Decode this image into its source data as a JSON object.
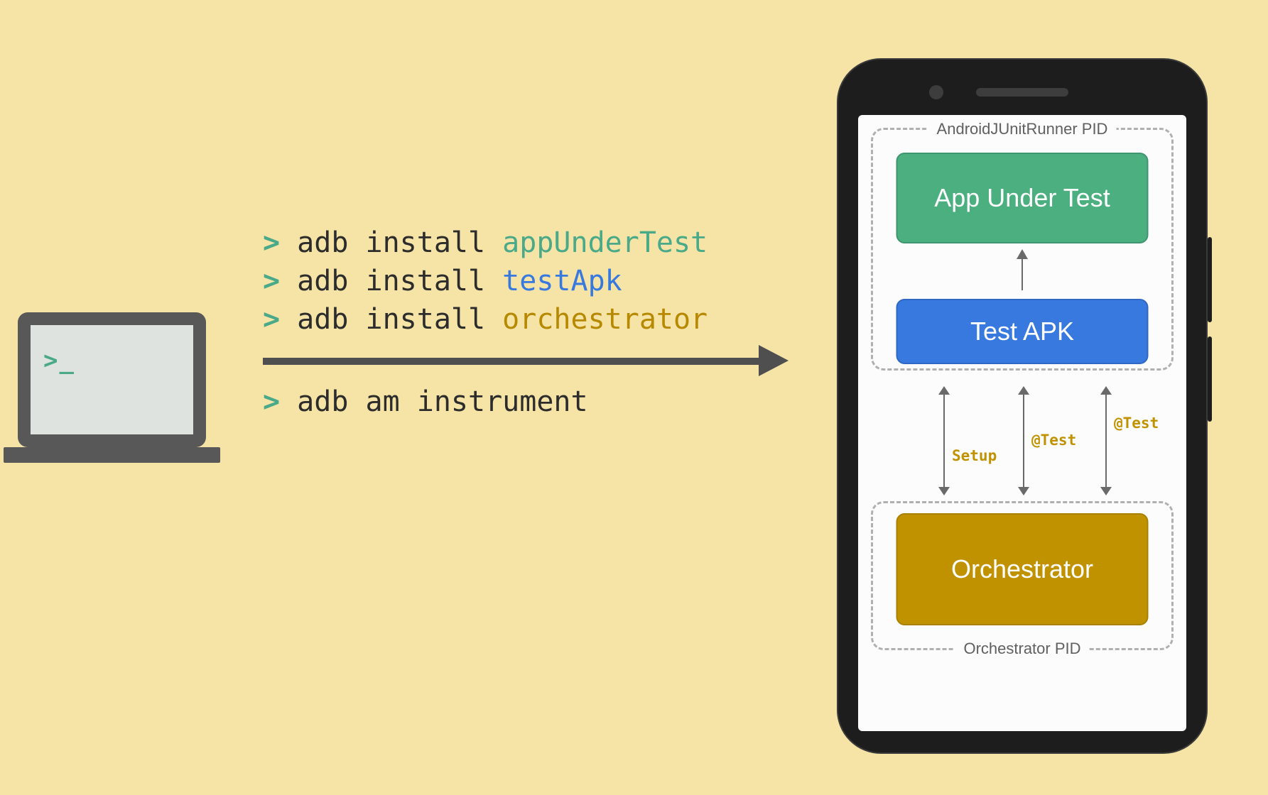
{
  "laptop_prompt": ">_",
  "commands": [
    {
      "caret": "> ",
      "base": "adb install ",
      "arg": "appUnderTest",
      "arg_class": "arg-green"
    },
    {
      "caret": "> ",
      "base": "adb install ",
      "arg": "testApk",
      "arg_class": "arg-blue"
    },
    {
      "caret": "> ",
      "base": "adb install ",
      "arg": "orchestrator",
      "arg_class": "arg-gold"
    }
  ],
  "command_after_arrow": {
    "caret": "> ",
    "base": "adb am instrument"
  },
  "phone": {
    "group_top_label": "AndroidJUnitRunner PID",
    "group_bot_label": "Orchestrator PID",
    "block_app": "App Under Test",
    "block_test": "Test APK",
    "block_orch": "Orchestrator",
    "seq_labels": [
      "Setup",
      "@Test",
      "@Test"
    ]
  }
}
